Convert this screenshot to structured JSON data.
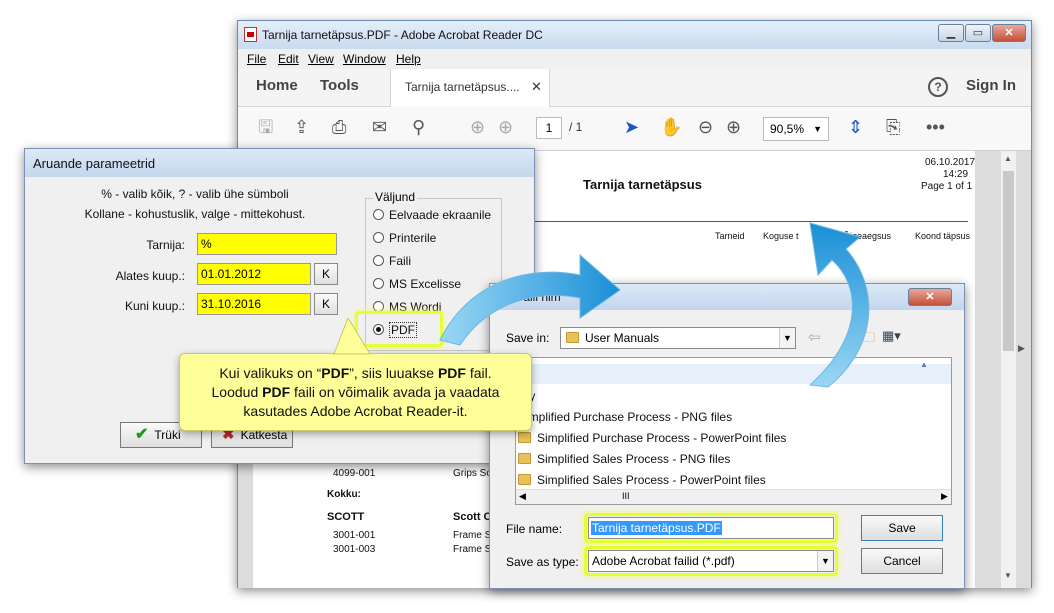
{
  "acrobat": {
    "title": "Tarnija tarnetäpsus.PDF - Adobe Acrobat Reader DC",
    "menu": [
      "File",
      "Edit",
      "View",
      "Window",
      "Help"
    ],
    "nav_home": "Home",
    "nav_tools": "Tools",
    "doc_tab": "Tarnija tarnetäpsus....",
    "help": "?",
    "sign_in": "Sign In",
    "page_current": "1",
    "page_total": "/ 1",
    "zoom": "90,5%",
    "report": {
      "title": "Tarnija tarnetäpsus",
      "date": "06.10.2017",
      "time": "14:29",
      "page": "Page 1 of 1",
      "col_tarneid": "Tarneid",
      "col_koguse": "Koguse t",
      "col_oigeaegsus": "Õigeaegsus",
      "col_koond": "Koond täpsus",
      "row1_code": "4099-001",
      "row1_desc": "Grips So",
      "kokku": "Kokku:",
      "supplier_code": "SCOTT",
      "supplier_name": "Scott C",
      "row2_code": "3001-001",
      "row2_desc": "Frame S",
      "row3_code": "3001-003",
      "row3_desc": "Frame S"
    }
  },
  "aruande": {
    "title": "Aruande parameetrid",
    "info_line1": "% - valib kõik, ? - valib ühe sümboli",
    "info_line2": "Kollane - kohustuslik, valge - mittekohust.",
    "tarnija_label": "Tarnija:",
    "tarnija_value": "%",
    "alates_label": "Alates kuup.:",
    "alates_value": "01.01.2012",
    "kuni_label": "Kuni kuup.:",
    "kuni_value": "31.10.2016",
    "k_button": "K",
    "valjund_label": "Väljund",
    "options": [
      "Eelvaade ekraanile",
      "Printerile",
      "Faili",
      "MS Excelisse",
      "MS Wordi",
      "PDF"
    ],
    "selected": "PDF",
    "truki_label": "Trüki",
    "katkesta_label": "Katkesta"
  },
  "callout": {
    "line1_pre": "Kui valikuks on “",
    "line1_b1": "PDF",
    "line1_mid": "”, siis luuakse ",
    "line1_b2": "PDF",
    "line1_post": " fail.",
    "line2_pre": "Loodud ",
    "line2_b": "PDF",
    "line2_post": " faili on võimalik avada ja vaadata",
    "line3": "kasutades Adobe Acrobat Reader-it."
  },
  "save_dialog": {
    "title": "Faili nim",
    "save_in_label": "Save in:",
    "save_in_value": "User Manuals",
    "files": [
      "licy",
      "Simplified Purchase Process - PNG files",
      "Simplified Purchase Process - PowerPoint files",
      "Simplified Sales Process - PNG files",
      "Simplified Sales Process - PowerPoint files"
    ],
    "file_name_label": "File name:",
    "file_name_value": "Tarnija tarnetäpsus.PDF",
    "save_type_label": "Save as type:",
    "save_type_value": "Adobe Acrobat failid (*.pdf)",
    "save_button": "Save",
    "cancel_button": "Cancel",
    "scroll_mid": "III"
  },
  "colors": {
    "highlight": "#e6ff33",
    "callout": "#ffff99",
    "arrow": "#2aa3e0",
    "yellow_field": "#ffff00"
  }
}
